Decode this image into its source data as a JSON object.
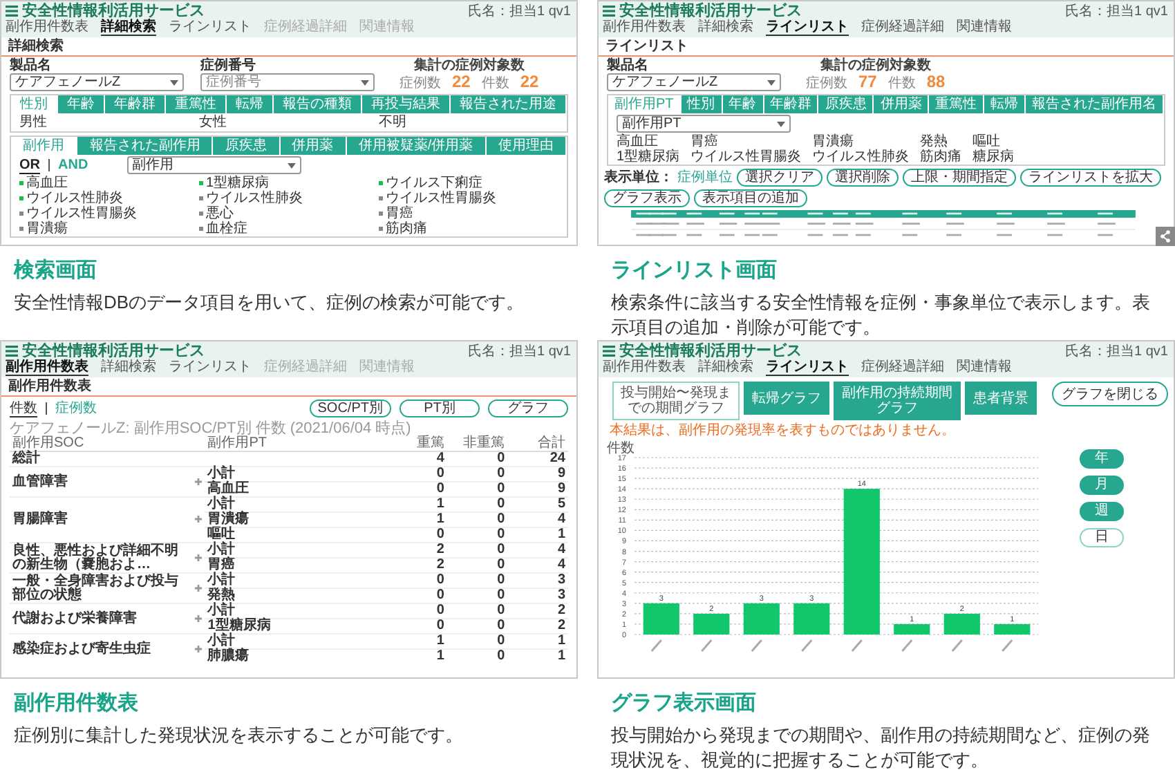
{
  "search_screen": {
    "header": {
      "logo": "安全性情報利活用サービス",
      "user": "氏名：担当1 qv1",
      "nav": [
        {
          "label": "副作用件数表",
          "selected": false,
          "disabled": false
        },
        {
          "label": "詳細検索",
          "selected": true,
          "disabled": false
        },
        {
          "label": "ラインリスト",
          "selected": false,
          "disabled": false
        },
        {
          "label": "症例経過詳細",
          "selected": false,
          "disabled": true
        },
        {
          "label": "関連情報",
          "selected": false,
          "disabled": true
        }
      ]
    },
    "page_title": "詳細検索",
    "fields": [
      {
        "label": "製品名",
        "value": "ケアフェノールZ"
      },
      {
        "label": "症例番号",
        "placeholder": "症例番号"
      }
    ],
    "summary": {
      "title": "集計の症例対象数",
      "counts": [
        {
          "label": "症例数",
          "value": "22"
        },
        {
          "label": "件数",
          "value": "22"
        }
      ]
    },
    "attribute_tabs": [
      {
        "label": "性別",
        "selected": true
      },
      {
        "label": "年齢",
        "selected": false
      },
      {
        "label": "年齢群",
        "selected": false
      },
      {
        "label": "重篤性",
        "selected": false
      },
      {
        "label": "転帰",
        "selected": false
      },
      {
        "label": "報告の種類",
        "selected": false
      },
      {
        "label": "再投与結果",
        "selected": false
      },
      {
        "label": "報告された用途",
        "selected": false
      }
    ],
    "attribute_options": [
      "男性",
      "女性",
      "不明"
    ],
    "event_tabs": [
      {
        "label": "副作用",
        "selected": true
      },
      {
        "label": "報告された副作用",
        "selected": false
      },
      {
        "label": "原疾患",
        "selected": false
      },
      {
        "label": "併用薬",
        "selected": false
      },
      {
        "label": "併用被疑薬/併用薬",
        "selected": false
      },
      {
        "label": "使用理由",
        "selected": false
      }
    ],
    "logic": [
      {
        "label": "OR",
        "selected": true
      },
      {
        "label": "AND",
        "selected": false
      }
    ],
    "event_select": {
      "value": "副作用"
    },
    "event_items": [
      {
        "label": "高血圧",
        "checked": true
      },
      {
        "label": "1型糖尿病",
        "checked": true
      },
      {
        "label": "ウイルス下痢症",
        "checked": true
      },
      {
        "label": "ウイルス性肺炎",
        "checked": true
      },
      {
        "label": "ウイルス性肺炎",
        "checked": false
      },
      {
        "label": "ウイルス性胃腸炎",
        "checked": false
      },
      {
        "label": "ウイルス性胃腸炎",
        "checked": false
      },
      {
        "label": "悪心",
        "checked": false
      },
      {
        "label": "胃癌",
        "checked": false
      },
      {
        "label": "胃潰瘍",
        "checked": false
      },
      {
        "label": "血栓症",
        "checked": false
      },
      {
        "label": "筋肉痛",
        "checked": false
      }
    ],
    "caption": {
      "title": "検索画面",
      "text": "安全性情報DBのデータ項目を用いて、症例の検索が可能です。"
    }
  },
  "line_list_screen": {
    "header": {
      "logo": "安全性情報利活用サービス",
      "user": "氏名：担当1 qv1",
      "nav": [
        {
          "label": "副作用件数表",
          "selected": false,
          "disabled": false
        },
        {
          "label": "詳細検索",
          "selected": false,
          "disabled": false
        },
        {
          "label": "ラインリスト",
          "selected": true,
          "disabled": false
        },
        {
          "label": "症例経過詳細",
          "selected": false,
          "disabled": false
        },
        {
          "label": "関連情報",
          "selected": false,
          "disabled": false
        }
      ]
    },
    "page_title": "ラインリスト",
    "fields": [
      {
        "label": "製品名",
        "value": "ケアフェノールZ"
      }
    ],
    "summary": {
      "title": "集計の症例対象数",
      "counts": [
        {
          "label": "症例数",
          "value": "77"
        },
        {
          "label": "件数",
          "value": "88"
        }
      ]
    },
    "tabs": [
      {
        "label": "副作用PT",
        "selected": true
      },
      {
        "label": "性別",
        "selected": false
      },
      {
        "label": "年齢",
        "selected": false
      },
      {
        "label": "年齢群",
        "selected": false
      },
      {
        "label": "原疾患",
        "selected": false
      },
      {
        "label": "併用薬",
        "selected": false
      },
      {
        "label": "重篤性",
        "selected": false
      },
      {
        "label": "転帰",
        "selected": false
      },
      {
        "label": "報告された副作用名",
        "selected": false
      }
    ],
    "select": {
      "value": "副作用PT"
    },
    "items": [
      "高血圧",
      "胃癌",
      "胃潰瘍",
      "発熱",
      "嘔吐",
      "1型糖尿病",
      "ウイルス性胃腸炎",
      "ウイルス性肺炎",
      "筋肉痛",
      "糖尿病"
    ],
    "unit": {
      "label": "表示単位：",
      "value": "症例単位"
    },
    "buttons": [
      "選択クリア",
      "選択削除",
      "上限・期間指定",
      "ラインリストを拡大",
      "グラフ表示",
      "表示項目の追加"
    ],
    "caption": {
      "title": "ラインリスト画面",
      "text": "検索条件に該当する安全性情報を症例・事象単位で表示します。表示項目の追加・削除が可能です。"
    }
  },
  "count_screen": {
    "header": {
      "logo": "安全性情報利活用サービス",
      "user": "氏名：担当1 qv1",
      "nav": [
        {
          "label": "副作用件数表",
          "selected": true,
          "disabled": false
        },
        {
          "label": "詳細検索",
          "selected": false,
          "disabled": false
        },
        {
          "label": "ラインリスト",
          "selected": false,
          "disabled": false
        },
        {
          "label": "症例経過詳細",
          "selected": false,
          "disabled": true
        },
        {
          "label": "関連情報",
          "selected": false,
          "disabled": true
        }
      ]
    },
    "page_title": "副作用件数表",
    "modes": [
      {
        "label": "件数",
        "selected": true
      },
      {
        "label": "症例数",
        "selected": false
      }
    ],
    "buttons": [
      "SOC/PT別",
      "PT別",
      "グラフ"
    ],
    "table_title": "ケアフェノールZ: 副作用SOC/PT別 件数 (2021/06/04 時点)",
    "columns": [
      "副作用SOC",
      "副作用PT",
      "重篤",
      "非重篤",
      "合計"
    ],
    "total": {
      "label": "総計",
      "values": [
        "4",
        "0",
        "24"
      ]
    },
    "groups": [
      {
        "soc": "血管障害",
        "rows": [
          {
            "pt": "小計",
            "values": [
              "0",
              "0",
              "9"
            ]
          },
          {
            "pt": "高血圧",
            "values": [
              "0",
              "0",
              "9"
            ]
          }
        ]
      },
      {
        "soc": "胃腸障害",
        "rows": [
          {
            "pt": "小計",
            "values": [
              "1",
              "0",
              "5"
            ]
          },
          {
            "pt": "胃潰瘍",
            "values": [
              "1",
              "0",
              "4"
            ]
          },
          {
            "pt": "嘔吐",
            "values": [
              "0",
              "0",
              "1"
            ]
          }
        ]
      },
      {
        "soc": "良性、悪性および詳細不明の新生物（嚢胞およ…",
        "rows": [
          {
            "pt": "小計",
            "values": [
              "2",
              "0",
              "4"
            ]
          },
          {
            "pt": "胃癌",
            "values": [
              "2",
              "0",
              "4"
            ]
          }
        ]
      },
      {
        "soc": "一般・全身障害および投与部位の状態",
        "rows": [
          {
            "pt": "小計",
            "values": [
              "0",
              "0",
              "3"
            ]
          },
          {
            "pt": "発熱",
            "values": [
              "0",
              "0",
              "3"
            ]
          }
        ]
      },
      {
        "soc": "代謝および栄養障害",
        "rows": [
          {
            "pt": "小計",
            "values": [
              "0",
              "0",
              "2"
            ]
          },
          {
            "pt": "1型糖尿病",
            "values": [
              "0",
              "0",
              "2"
            ]
          }
        ]
      },
      {
        "soc": "感染症および寄生虫症",
        "rows": [
          {
            "pt": "小計",
            "values": [
              "1",
              "0",
              "1"
            ]
          },
          {
            "pt": "肺膿瘍",
            "values": [
              "1",
              "0",
              "1"
            ]
          }
        ]
      }
    ],
    "caption": {
      "title": "副作用件数表",
      "text": "症例別に集計した発現状況を表示することが可能です。"
    }
  },
  "graph_screen": {
    "header": {
      "logo": "安全性情報利活用サービス",
      "user": "氏名：担当1 qv1",
      "nav": [
        {
          "label": "副作用件数表",
          "selected": false,
          "disabled": false
        },
        {
          "label": "詳細検索",
          "selected": false,
          "disabled": false
        },
        {
          "label": "ラインリスト",
          "selected": true,
          "disabled": false
        },
        {
          "label": "症例経過詳細",
          "selected": false,
          "disabled": false
        },
        {
          "label": "関連情報",
          "selected": false,
          "disabled": false
        }
      ]
    },
    "tabs": [
      {
        "label": "投与開始〜発現までの期間グラフ",
        "selected": true
      },
      {
        "label": "転帰グラフ",
        "selected": false
      },
      {
        "label": "副作用の持続期間グラフ",
        "selected": false
      },
      {
        "label": "患者背景",
        "selected": false
      }
    ],
    "close_button": "グラフを閉じる",
    "notice": "本結果は、副作用の発現率を表すものではありません。",
    "chart_data": {
      "type": "bar",
      "ylabel": "件数",
      "values": [
        3,
        2,
        3,
        3,
        14,
        1,
        2,
        1
      ],
      "ylim": [
        0,
        17
      ],
      "grid": true,
      "yticks": [
        0,
        1,
        2,
        3,
        4,
        5,
        6,
        7,
        8,
        9,
        10,
        11,
        12,
        13,
        14,
        15,
        16,
        17
      ],
      "data_labels": true
    },
    "units": [
      {
        "label": "年",
        "selected": false
      },
      {
        "label": "月",
        "selected": false
      },
      {
        "label": "週",
        "selected": false
      },
      {
        "label": "日",
        "selected": true
      }
    ],
    "caption": {
      "title": "グラフ表示画面",
      "text": "投与開始から発現までの期間や、副作用の持続期間など、症例の発現状況を、視覚的に把握することが可能です。"
    }
  }
}
